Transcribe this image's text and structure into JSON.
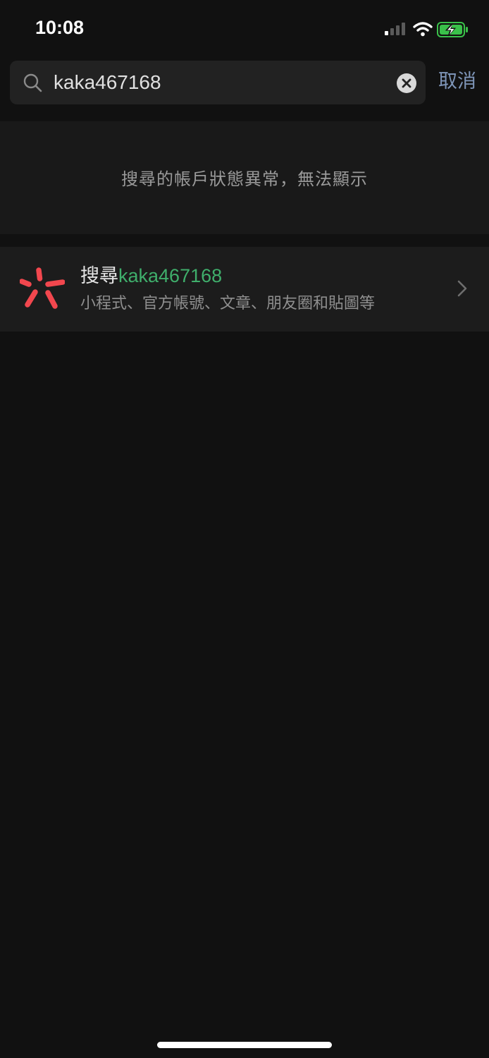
{
  "status_bar": {
    "time": "10:08",
    "icons": [
      "cellular-signal-icon",
      "wifi-icon",
      "battery-charging-icon"
    ],
    "battery_color": "#3ac14a"
  },
  "search": {
    "query": "kaka467168",
    "cancel_label": "取消"
  },
  "notice": {
    "message": "搜尋的帳戶狀態異常，無法顯示"
  },
  "web_search": {
    "prefix": "搜尋",
    "keyword": "kaka467168",
    "subtitle": "小程式、官方帳號、文章、朋友圈和貼圖等",
    "icon": "search-logo-icon",
    "accent_color": "#3fae6b",
    "logo_color": "#f2474e"
  },
  "colors": {
    "background": "#111111",
    "link": "#7e95b8"
  }
}
